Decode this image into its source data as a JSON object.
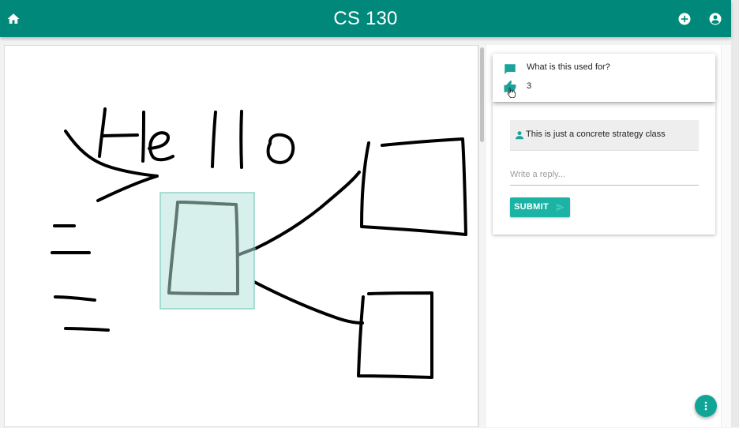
{
  "header": {
    "title": "CS 130",
    "color": "#00897b"
  },
  "icons": {
    "home": "home-icon",
    "add": "add-circle-icon",
    "account": "account-circle-icon",
    "comment": "comment-icon",
    "thumb_up": "thumb-up-icon",
    "person": "person-icon",
    "send": "send-icon",
    "more": "more-vert-icon"
  },
  "question": {
    "text": "What is this used for?",
    "likes": "3"
  },
  "reply": {
    "text": "This is just a concrete strategy class"
  },
  "reply_input": {
    "placeholder": "Write a reply..."
  },
  "submit": {
    "label": "SUBMIT"
  },
  "canvas": {
    "stroke_color": "#000000",
    "selection_fill": "#d8f0ec",
    "selection_border": "#8fd3c9"
  }
}
